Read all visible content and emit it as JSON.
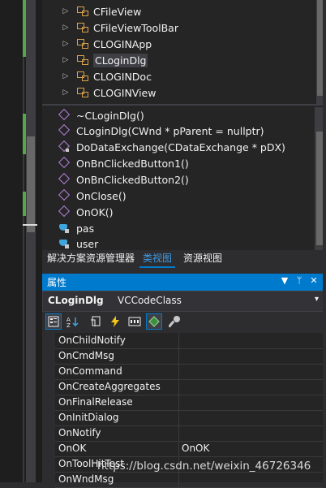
{
  "class_view": {
    "tree_items": [
      {
        "label": "CFileView",
        "selected": false
      },
      {
        "label": "CFileViewToolBar",
        "selected": false
      },
      {
        "label": "CLOGINApp",
        "selected": false
      },
      {
        "label": "CLoginDlg",
        "selected": true
      },
      {
        "label": "CLOGINDoc",
        "selected": false
      },
      {
        "label": "CLOGINView",
        "selected": false
      }
    ],
    "members": [
      {
        "label": "~CLoginDlg()",
        "icon": "method-icon"
      },
      {
        "label": "CLoginDlg(CWnd * pParent = nullptr)",
        "icon": "method-icon"
      },
      {
        "label": "DoDataExchange(CDataExchange * pDX)",
        "icon": "protected-method-icon"
      },
      {
        "label": "OnBnClickedButton1()",
        "icon": "method-icon"
      },
      {
        "label": "OnBnClickedButton2()",
        "icon": "method-icon"
      },
      {
        "label": "OnClose()",
        "icon": "method-icon"
      },
      {
        "label": "OnOK()",
        "icon": "method-icon"
      },
      {
        "label": "pas",
        "icon": "field-icon"
      },
      {
        "label": "user",
        "icon": "field-icon"
      }
    ]
  },
  "tabs": {
    "solution_explorer": "解决方案资源管理器",
    "class_view": "类视图",
    "resource_view": "资源视图"
  },
  "properties": {
    "title": "属性",
    "header_dropdown": "▼",
    "header_pin": "ᛘ",
    "header_close": "✕",
    "object_name": "CLoginDlg",
    "object_type": "VCCodeClass",
    "rows": [
      {
        "name": "OnChildNotify",
        "value": ""
      },
      {
        "name": "OnCmdMsg",
        "value": ""
      },
      {
        "name": "OnCommand",
        "value": ""
      },
      {
        "name": "OnCreateAggregates",
        "value": ""
      },
      {
        "name": "OnFinalRelease",
        "value": ""
      },
      {
        "name": "OnInitDialog",
        "value": ""
      },
      {
        "name": "OnNotify",
        "value": ""
      },
      {
        "name": "OnOK",
        "value": "OnOK"
      },
      {
        "name": "OnToolHitTest",
        "value": ""
      },
      {
        "name": "OnWndMsg",
        "value": ""
      }
    ]
  },
  "watermark": "https://blog.csdn.net/weixin_46726346",
  "colors": {
    "accent": "#007acc",
    "method_icon": "#b180d7",
    "field_icon": "#3ea6dd",
    "class_icon": "#d9a24a"
  }
}
